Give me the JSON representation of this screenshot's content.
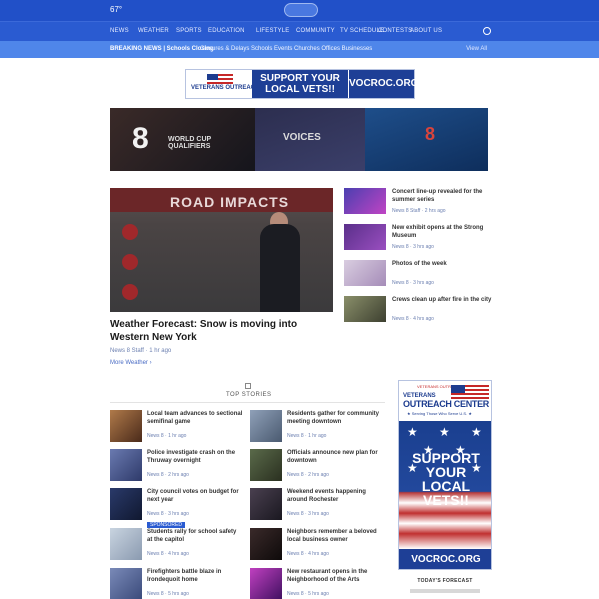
{
  "header": {
    "weather": "67°",
    "nav": [
      "NEWS",
      "WEATHER",
      "SPORTS",
      "EDUCATION",
      "LIFESTYLE",
      "COMMUNITY",
      "TV SCHEDULE",
      "CONTESTS",
      "ABOUT US"
    ],
    "ticker_label": "BREAKING NEWS | Schools Closing",
    "ticker_text": "Closures & Delays  Schools  Events  Churches  Offices  Businesses",
    "ticker_more": "View All"
  },
  "ad_top": {
    "brand_line": "VETERANS OUTREACH CENTER",
    "headline": "SUPPORT YOUR LOCAL VETS!!",
    "url": "VOCROC.ORG"
  },
  "banner": {
    "channel": "8",
    "panel1": "WORLD CUP QUALIFIERS",
    "panel2": "VOICES",
    "panel3": "8"
  },
  "hero": {
    "graphic_title": "ROAD IMPACTS",
    "title": "Weather Forecast: Snow is moving into Western New York",
    "meta": "News 8 Staff · 1 hr ago",
    "more": "More Weather ›"
  },
  "side_stories": [
    {
      "title": "Concert line-up revealed for the summer series",
      "meta": "News 8 Staff · 2 hrs ago"
    },
    {
      "title": "New exhibit opens at the Strong Museum",
      "meta": "News 8 · 3 hrs ago"
    },
    {
      "title": "Photos of the week",
      "meta": "News 8 · 3 hrs ago"
    },
    {
      "title": "Crews clean up after fire in the city",
      "meta": "News 8 · 4 hrs ago"
    }
  ],
  "section": {
    "title": "TOP STORIES"
  },
  "grid_stories": [
    {
      "title": "Local team advances to sectional semifinal game",
      "meta": "News 8 · 1 hr ago",
      "badge": ""
    },
    {
      "title": "Residents gather for community meeting downtown",
      "meta": "News 8 · 1 hr ago",
      "badge": ""
    },
    {
      "title": "Police investigate crash on the Thruway overnight",
      "meta": "News 8 · 2 hrs ago",
      "badge": ""
    },
    {
      "title": "Officials announce new plan for downtown",
      "meta": "News 8 · 2 hrs ago",
      "badge": ""
    },
    {
      "title": "City council votes on budget for next year",
      "meta": "News 8 · 3 hrs ago",
      "badge": ""
    },
    {
      "title": "Weekend events happening around Rochester",
      "meta": "News 8 · 3 hrs ago",
      "badge": ""
    },
    {
      "title": "Students rally for school safety at the capitol",
      "meta": "News 8 · 4 hrs ago",
      "badge": "SPONSORED"
    },
    {
      "title": "Neighbors remember a beloved local business owner",
      "meta": "News 8 · 4 hrs ago",
      "badge": ""
    },
    {
      "title": "Firefighters battle blaze in Irondequoit home",
      "meta": "News 8 · 5 hrs ago",
      "badge": ""
    },
    {
      "title": "New restaurant opens in the Neighborhood of the Arts",
      "meta": "News 8 · 5 hrs ago",
      "badge": ""
    }
  ],
  "ad_right": {
    "small": "VETERANS OUTREACH CENTER",
    "line1": "VETERANS",
    "line2": "OUTREACH CENTER Inc.",
    "tag": "★ Serving Those Who Serve U.S. ★",
    "slogan1": "SUPPORT",
    "slogan2": "YOUR",
    "slogan3": "LOCAL",
    "slogan4": "VETS!!",
    "url": "VOCROC.ORG"
  },
  "forecast": {
    "title": "TODAY'S FORECAST"
  },
  "colors": {
    "brand_blue": "#2150c8",
    "ticker_blue": "#4f86ea",
    "ad_navy": "#1e3f96",
    "flag_red": "#c62828"
  }
}
